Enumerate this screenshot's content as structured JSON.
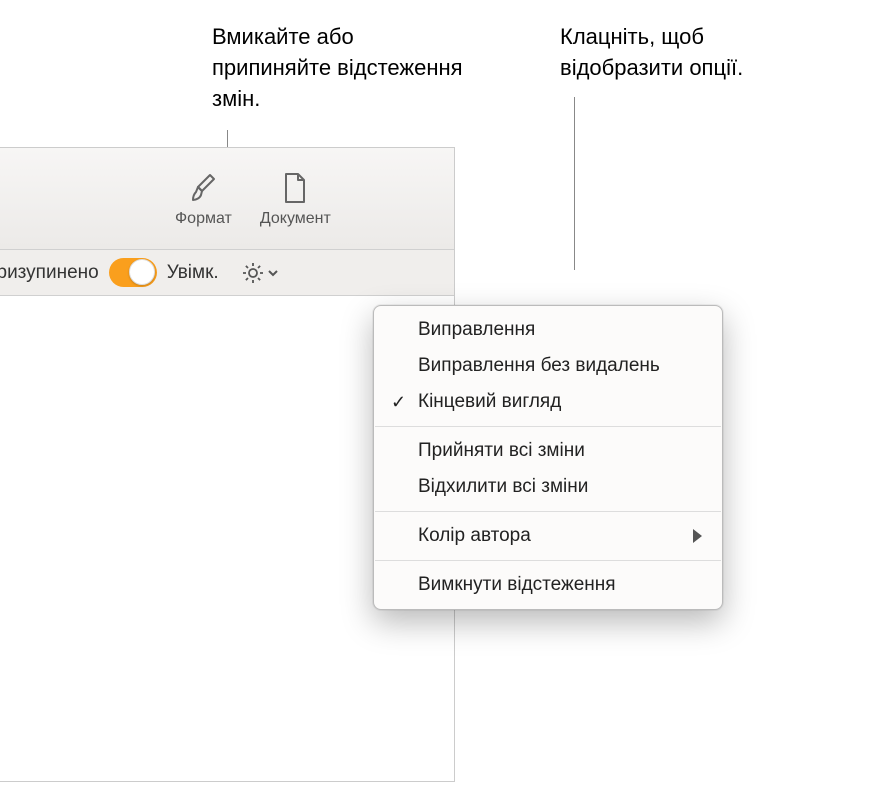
{
  "annotations": {
    "left": "Вмикайте або припиняйте відстеження змін.",
    "right": "Клацніть, щоб відобразити опції."
  },
  "toolbar": {
    "format_label": "Формат",
    "document_label": "Документ"
  },
  "status_bar": {
    "prefix": "я: Призупинено",
    "on_label": "Увімк."
  },
  "menu": {
    "items": {
      "corrections": "Виправлення",
      "corrections_no_deletions": "Виправлення без видалень",
      "final_view": "Кінцевий вигляд",
      "accept_all": "Прийняти всі зміни",
      "reject_all": "Відхилити всі зміни",
      "author_color": "Колір автора",
      "disable_tracking": "Вимкнути відстеження"
    }
  }
}
